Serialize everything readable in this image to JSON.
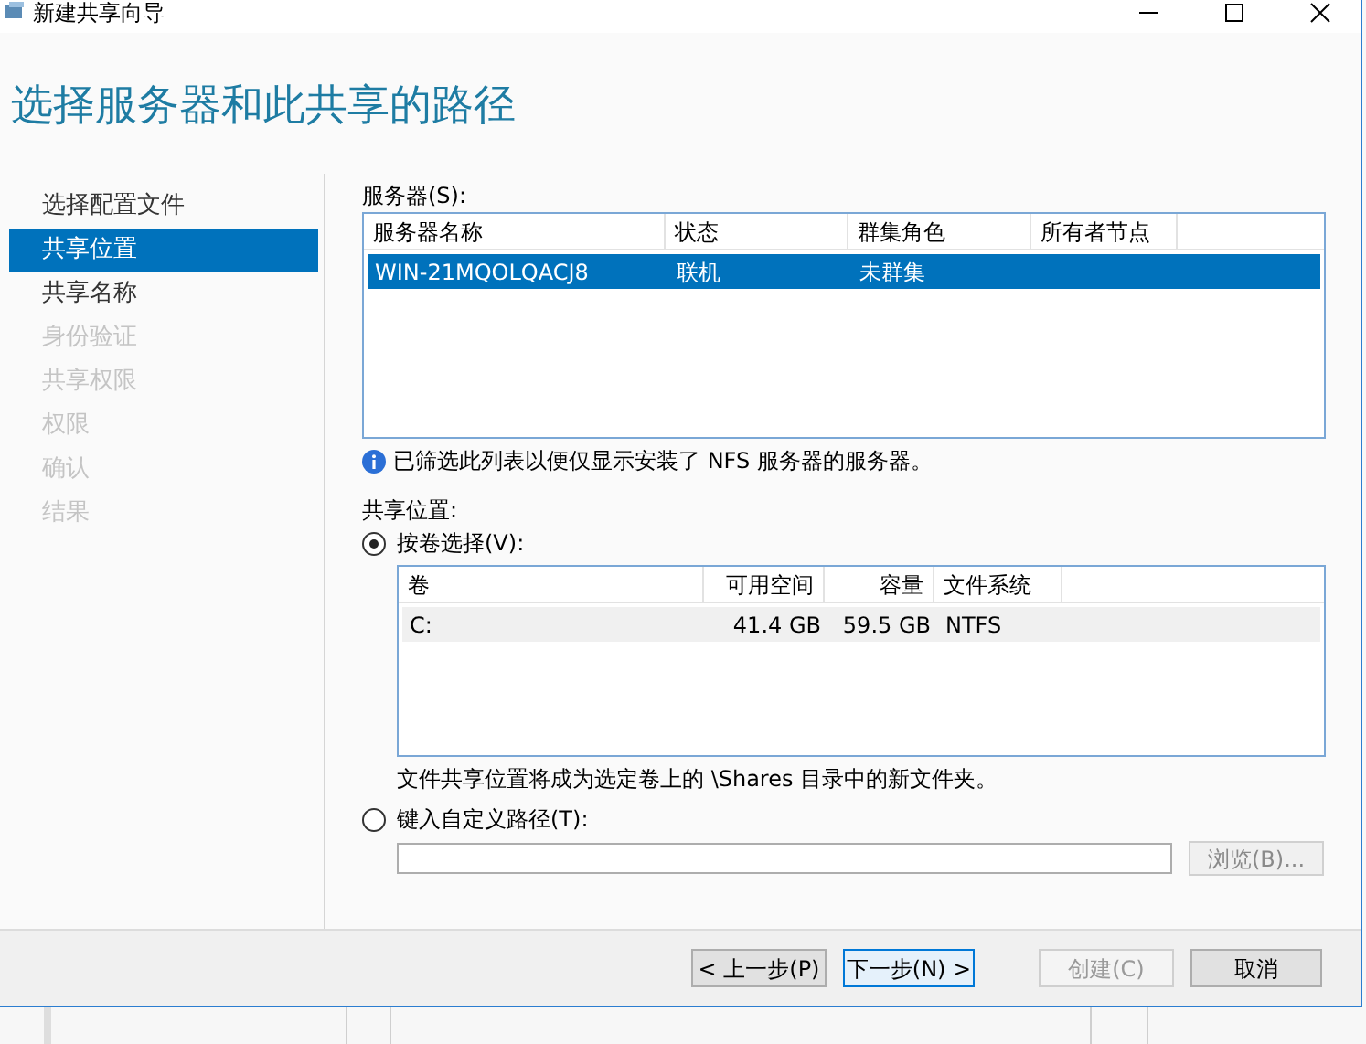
{
  "window": {
    "title": "新建共享向导"
  },
  "header": {
    "title": "选择服务器和此共享的路径"
  },
  "sidebar": {
    "items": [
      {
        "label": "选择配置文件",
        "selected": false,
        "disabled": false
      },
      {
        "label": "共享位置",
        "selected": true,
        "disabled": false
      },
      {
        "label": "共享名称",
        "selected": false,
        "disabled": false
      },
      {
        "label": "身份验证",
        "selected": false,
        "disabled": true
      },
      {
        "label": "共享权限",
        "selected": false,
        "disabled": true
      },
      {
        "label": "权限",
        "selected": false,
        "disabled": true
      },
      {
        "label": "确认",
        "selected": false,
        "disabled": true
      },
      {
        "label": "结果",
        "selected": false,
        "disabled": true
      }
    ]
  },
  "servers": {
    "label": "服务器(S):",
    "columns": [
      "服务器名称",
      "状态",
      "群集角色",
      "所有者节点"
    ],
    "rows": [
      {
        "cells": [
          "WIN-21MQOLQACJ8",
          "联机",
          "未群集",
          ""
        ],
        "selected": true
      }
    ]
  },
  "info": "已筛选此列表以便仅显示安装了 NFS 服务器的服务器。",
  "location": {
    "label": "共享位置:",
    "options": [
      {
        "label": "按卷选择(V):",
        "selected": true
      },
      {
        "label": "键入自定义路径(T):",
        "selected": false
      }
    ],
    "volumes": {
      "columns": [
        "卷",
        "可用空间",
        "容量",
        "文件系统"
      ],
      "rows": [
        {
          "cells": [
            "C:",
            "41.4 GB",
            "59.5 GB",
            "NTFS"
          ],
          "selected": true
        }
      ]
    },
    "note": "文件共享位置将成为选定卷上的 \\Shares 目录中的新文件夹。",
    "browse": {
      "label": "浏览(B)...",
      "disabled": true
    }
  },
  "buttons": [
    {
      "label": "< 上一步(P)",
      "disabled": false,
      "default": false
    },
    {
      "label": "下一步(N) >",
      "disabled": false,
      "default": true
    },
    {
      "label": "创建(C)",
      "disabled": true,
      "default": false
    },
    {
      "label": "取消",
      "disabled": false,
      "default": false
    }
  ]
}
